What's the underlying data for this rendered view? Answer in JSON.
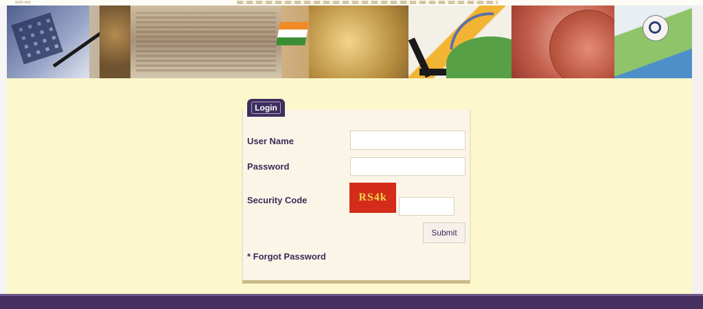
{
  "header": {
    "small_text": "xxxx xxx"
  },
  "login": {
    "tab_label": "Login",
    "username_label": "User Name",
    "username_value": "",
    "password_label": "Password",
    "password_value": "",
    "security_code_label": "Security Code",
    "captcha_text": "RS4k",
    "security_code_value": "",
    "submit_label": "Submit",
    "forgot_label": "* Forgot Password"
  },
  "colors": {
    "main_background": "#fdf8cc",
    "footer": "#45305f",
    "accent": "#3d2e5e",
    "captcha_background": "#d42b1a"
  }
}
